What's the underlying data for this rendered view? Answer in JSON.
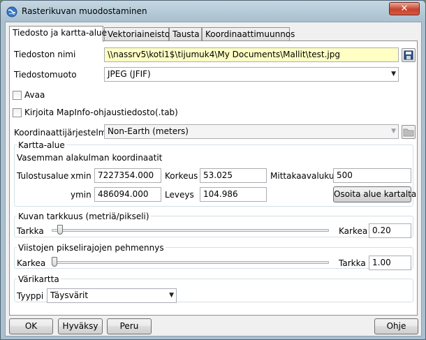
{
  "window": {
    "title": "Rasterikuvan muodostaminen",
    "close_label": "✕"
  },
  "tabs": [
    {
      "label": "Tiedosto ja kartta-alue"
    },
    {
      "label": "Vektoriaineisto"
    },
    {
      "label": "Tausta"
    },
    {
      "label": "Koordinaattimuunnos"
    }
  ],
  "file": {
    "name_label": "Tiedoston nimi",
    "name_value": "\\\\nassrv5\\koti1$\\tijumuk4\\My Documents\\Mallit\\test.jpg",
    "format_label": "Tiedostomuoto",
    "format_value": "JPEG (JFIF)",
    "open_label": "Avaa",
    "write_tab_label": "Kirjoita MapInfo-ohjaustiedosto(.tab)",
    "crs_label": "Koordinaattijärjestelmä",
    "crs_value": "Non-Earth (meters)"
  },
  "map_area": {
    "group_label": "Kartta-alue",
    "subtitle": "Vasemman alakulman koordinaatit",
    "output_label": "Tulostusalue",
    "xmin_label": "xmin",
    "xmin_value": "7227354.000",
    "ymin_label": "ymin",
    "ymin_value": "486094.000",
    "height_label": "Korkeus",
    "height_value": "53.025",
    "width_label": "Leveys",
    "width_value": "104.986",
    "scale_label": "Mittakaavaluku",
    "scale_value": "500",
    "pick_button": "Osoita alue kartalta"
  },
  "accuracy": {
    "group_label": "Kuvan tarkkuus (metriä/pikseli)",
    "left_label": "Tarkka",
    "right_label": "Karkea",
    "value": "0.20",
    "slider_fraction": 0.02
  },
  "smoothing": {
    "group_label": "Viistojen pikselirajojen pehmennys",
    "left_label": "Karkea",
    "right_label": "Tarkka",
    "value": "1.00",
    "slider_fraction": 0.0
  },
  "colormap": {
    "group_label": "Värikartta",
    "type_label": "Tyyppi",
    "type_value": "Täysvärit"
  },
  "footer": {
    "ok": "OK",
    "apply": "Hyväksy",
    "cancel": "Peru",
    "help": "Ohje"
  }
}
